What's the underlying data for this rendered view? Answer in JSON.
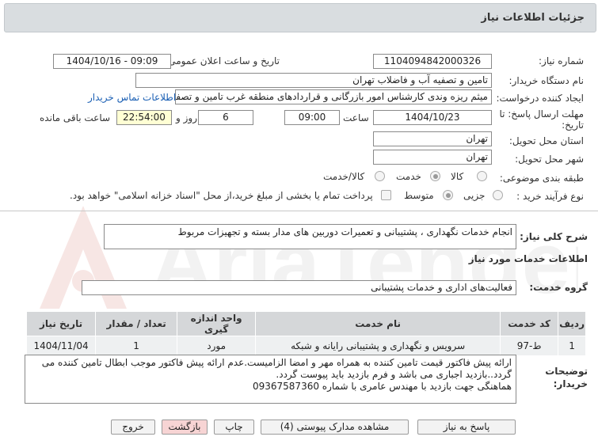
{
  "header": {
    "title": "جزئیات اطلاعات نیاز"
  },
  "fields": {
    "need_number_label": "شماره نیاز:",
    "need_number": "1104094842000326",
    "announce_label": "تاریخ و ساعت اعلان عمومی:",
    "announce_value": "1404/10/16 - 09:09",
    "buyer_org_label": "نام دستگاه خریدار:",
    "buyer_org": "تامین و تصفیه آب و فاضلاب تهران",
    "creator_label": "ایجاد کننده درخواست:",
    "creator": "میثم ریزه وندی کارشناس امور بازرگانی و قراردادهای منطقه غرب تامین و تصفیه",
    "contact_link": "اطلاعات تماس خریدار",
    "deadline_label_1": "مهلت ارسال پاسخ: تا",
    "deadline_label_2": "تاریخ:",
    "deadline_date": "1404/10/23",
    "time_label": "ساعت",
    "deadline_time": "09:00",
    "days_value": "6",
    "days_label": "روز و",
    "remaining_time": "22:54:00",
    "remaining_label": "ساعت باقی مانده",
    "province_label": "استان محل تحویل:",
    "province": "تهران",
    "city_label": "شهر محل تحویل:",
    "city": "تهران",
    "category_label": "طبقه بندی موضوعی:",
    "category_options": [
      "کالا",
      "خدمت",
      "کالا/خدمت"
    ],
    "category_selected": "خدمت",
    "process_label": "نوع فرآیند خرید :",
    "process_options": [
      "جزیی",
      "متوسط"
    ],
    "process_selected": "متوسط",
    "payment_note": "پرداخت تمام یا بخشی از مبلغ خرید،از محل \"اسناد خزانه اسلامی\" خواهد بود."
  },
  "description": {
    "label": "شرح کلی نیاز:",
    "value": "انجام خدمات نگهداری ، پشتیبانی و تعمیرات دوربین های مدار بسته و تجهیزات مربوط"
  },
  "services": {
    "section_title": "اطلاعات خدمات مورد نیاز",
    "group_label": "گروه خدمت:",
    "group_value": "فعالیت‌های اداری و خدمات پشتیبانی",
    "table": {
      "headers": [
        "ردیف",
        "کد خدمت",
        "نام خدمت",
        "واحد اندازه گیری",
        "تعداد / مقدار",
        "تاریخ نیاز"
      ],
      "rows": [
        [
          "1",
          "ط-97",
          "سرویس و نگهداری و پشتیبانی رایانه و شبکه",
          "مورد",
          "1",
          "1404/11/04"
        ]
      ]
    }
  },
  "notes": {
    "label_1": "توضیحات",
    "label_2": "خریدار:",
    "lines": [
      "ارائه پیش فاکتور قیمت تامین کننده به همراه مهر و امضا الزامیست.عدم ارائه پیش فاکتور موجب ابطال تامین کننده می",
      "گردد..بازدید اجباری می باشد و فرم بازدید باید پیوست گردد.",
      "هماهنگی جهت بازدید با مهندس عامری با شماره 09367587360"
    ]
  },
  "buttons": {
    "reply": "پاسخ به نیاز",
    "attachments": "مشاهده مدارک پیوستی (4)",
    "print": "چاپ",
    "back": "بازگشت",
    "exit": "خروج"
  },
  "watermark": {
    "text": "AriaTender.net"
  }
}
